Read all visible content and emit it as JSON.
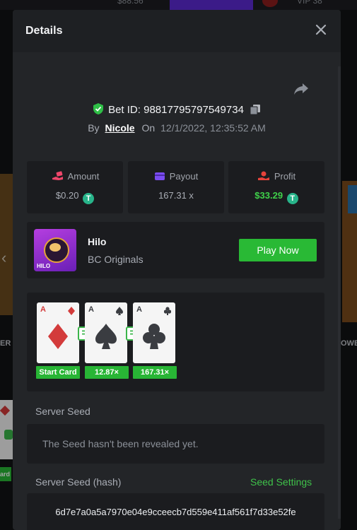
{
  "background": {
    "top_amount": "$88.56",
    "top_vip": "VIP 38",
    "left_text": "ER C",
    "right_text": "OWE",
    "left_tag": "ard"
  },
  "modal": {
    "title": "Details",
    "bet": {
      "label": "Bet ID: 98817795797549734",
      "by_label": "By",
      "user": "Nicole",
      "on_label": "On",
      "date": "12/1/2022, 12:35:52 AM"
    },
    "stats": [
      {
        "label": "Amount",
        "value": "$0.20",
        "icon": "money-hand-icon",
        "color": "#f0476b"
      },
      {
        "label": "Payout",
        "value": "167.31 x",
        "icon": "wallet-icon",
        "color": "#7a4cf0"
      },
      {
        "label": "Profit",
        "value": "$33.29",
        "icon": "profit-hand-icon",
        "color": "#e6433b"
      }
    ],
    "game": {
      "name": "Hilo",
      "provider": "BC Originals",
      "thumb_tag": "HILO",
      "play_label": "Play Now"
    },
    "cards": [
      {
        "rank": "A",
        "suit": "diamond",
        "tag": "Start Card"
      },
      {
        "rank": "A",
        "suit": "spade",
        "tag": "12.87×"
      },
      {
        "rank": "A",
        "suit": "club",
        "tag": "167.31×"
      }
    ],
    "equals_symbol": "=",
    "server_seed": {
      "label": "Server Seed",
      "message": "The Seed hasn't been revealed yet."
    },
    "server_seed_hash": {
      "label": "Server Seed (hash)",
      "settings_label": "Seed Settings",
      "hash": "6d7e7a0a5a7970e04e9cceecb7d559e411af561f7d33e52fe"
    },
    "coin_symbol": "T"
  }
}
